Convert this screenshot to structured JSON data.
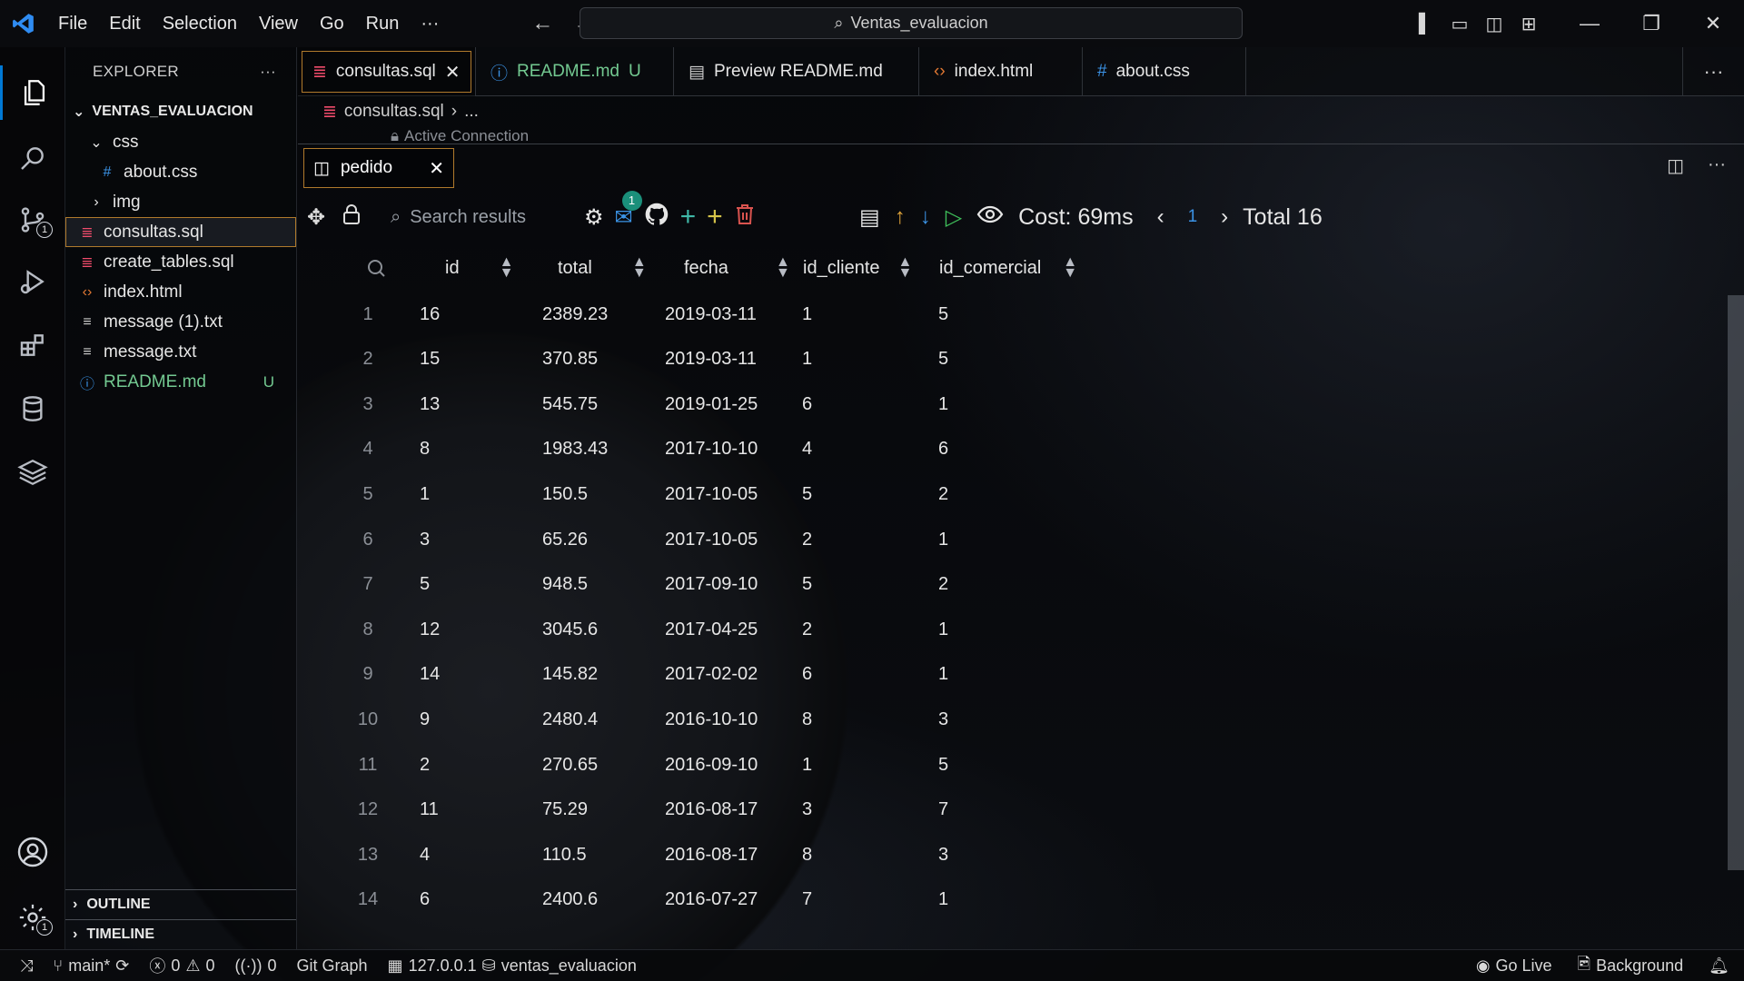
{
  "window": {
    "search_title": "Ventas_evaluacion"
  },
  "menu": [
    "File",
    "Edit",
    "Selection",
    "View",
    "Go",
    "Run",
    "···"
  ],
  "sidebar": {
    "header": "EXPLORER",
    "more": "···",
    "root": "VENTAS_EVALUACION",
    "items": [
      {
        "label": "css",
        "icon": "chevron-down-icon",
        "indent": 1
      },
      {
        "label": "about.css",
        "icon": "hash-icon",
        "indent": 2
      },
      {
        "label": "img",
        "icon": "chevron-right-icon",
        "indent": 1
      },
      {
        "label": "consultas.sql",
        "icon": "database-file-icon",
        "indent": 1,
        "selected": true
      },
      {
        "label": "create_tables.sql",
        "icon": "database-file-icon",
        "indent": 1
      },
      {
        "label": "index.html",
        "icon": "code-icon",
        "indent": 1
      },
      {
        "label": "message (1).txt",
        "icon": "text-file-icon",
        "indent": 1
      },
      {
        "label": "message.txt",
        "icon": "text-file-icon",
        "indent": 1
      },
      {
        "label": "README.md",
        "icon": "info-icon",
        "indent": 1,
        "status": "U",
        "color": "#73c991"
      }
    ],
    "outline": "OUTLINE",
    "timeline": "TIMELINE"
  },
  "tabs": [
    {
      "label": "consultas.sql",
      "icon": "database-file-icon",
      "icon_color": "#f14c6c",
      "active": true,
      "close": "✕"
    },
    {
      "label": "README.md",
      "icon": "info-icon",
      "icon_color": "#3b93e6",
      "modified": "U",
      "label_color": "#73c991"
    },
    {
      "label": "Preview README.md",
      "icon": "preview-icon",
      "icon_color": "#cfcfcf"
    },
    {
      "label": "index.html",
      "icon": "code-icon",
      "icon_color": "#e37933"
    },
    {
      "label": "about.css",
      "icon": "hash-icon",
      "icon_color": "#3b93e6"
    }
  ],
  "breadcrumb": {
    "file": "consultas.sql",
    "rest": "..."
  },
  "active_connection": "Active Connection",
  "result_tab": {
    "label": "pedido",
    "close": "✕"
  },
  "toolbar": {
    "search_placeholder": "Search results",
    "mail_badge": "1",
    "cost": "Cost: 69ms",
    "page": "1",
    "total": "Total 16"
  },
  "table": {
    "columns": [
      "id",
      "total",
      "fecha",
      "id_cliente",
      "id_comercial"
    ],
    "rows": [
      {
        "n": "1",
        "id": "16",
        "total": "2389.23",
        "fecha": "2019-03-11",
        "id_cliente": "1",
        "id_comercial": "5"
      },
      {
        "n": "2",
        "id": "15",
        "total": "370.85",
        "fecha": "2019-03-11",
        "id_cliente": "1",
        "id_comercial": "5"
      },
      {
        "n": "3",
        "id": "13",
        "total": "545.75",
        "fecha": "2019-01-25",
        "id_cliente": "6",
        "id_comercial": "1"
      },
      {
        "n": "4",
        "id": "8",
        "total": "1983.43",
        "fecha": "2017-10-10",
        "id_cliente": "4",
        "id_comercial": "6"
      },
      {
        "n": "5",
        "id": "1",
        "total": "150.5",
        "fecha": "2017-10-05",
        "id_cliente": "5",
        "id_comercial": "2"
      },
      {
        "n": "6",
        "id": "3",
        "total": "65.26",
        "fecha": "2017-10-05",
        "id_cliente": "2",
        "id_comercial": "1"
      },
      {
        "n": "7",
        "id": "5",
        "total": "948.5",
        "fecha": "2017-09-10",
        "id_cliente": "5",
        "id_comercial": "2"
      },
      {
        "n": "8",
        "id": "12",
        "total": "3045.6",
        "fecha": "2017-04-25",
        "id_cliente": "2",
        "id_comercial": "1"
      },
      {
        "n": "9",
        "id": "14",
        "total": "145.82",
        "fecha": "2017-02-02",
        "id_cliente": "6",
        "id_comercial": "1"
      },
      {
        "n": "10",
        "id": "9",
        "total": "2480.4",
        "fecha": "2016-10-10",
        "id_cliente": "8",
        "id_comercial": "3"
      },
      {
        "n": "11",
        "id": "2",
        "total": "270.65",
        "fecha": "2016-09-10",
        "id_cliente": "1",
        "id_comercial": "5"
      },
      {
        "n": "12",
        "id": "11",
        "total": "75.29",
        "fecha": "2016-08-17",
        "id_cliente": "3",
        "id_comercial": "7"
      },
      {
        "n": "13",
        "id": "4",
        "total": "110.5",
        "fecha": "2016-08-17",
        "id_cliente": "8",
        "id_comercial": "3"
      },
      {
        "n": "14",
        "id": "6",
        "total": "2400.6",
        "fecha": "2016-07-27",
        "id_cliente": "7",
        "id_comercial": "1"
      }
    ]
  },
  "activity_badges": {
    "source_control": "1",
    "settings": "1"
  },
  "statusbar": {
    "branch": "main*",
    "errors": "0",
    "warnings": "0",
    "ports": "0",
    "git_graph": "Git Graph",
    "host": "127.0.0.1",
    "database": "ventas_evaluacion",
    "go_live": "Go Live",
    "background": "Background"
  },
  "colors": {
    "accent": "#0078d4",
    "selected_border": "#b07a2c",
    "untracked": "#73c991",
    "link_blue": "#3b93e6"
  }
}
